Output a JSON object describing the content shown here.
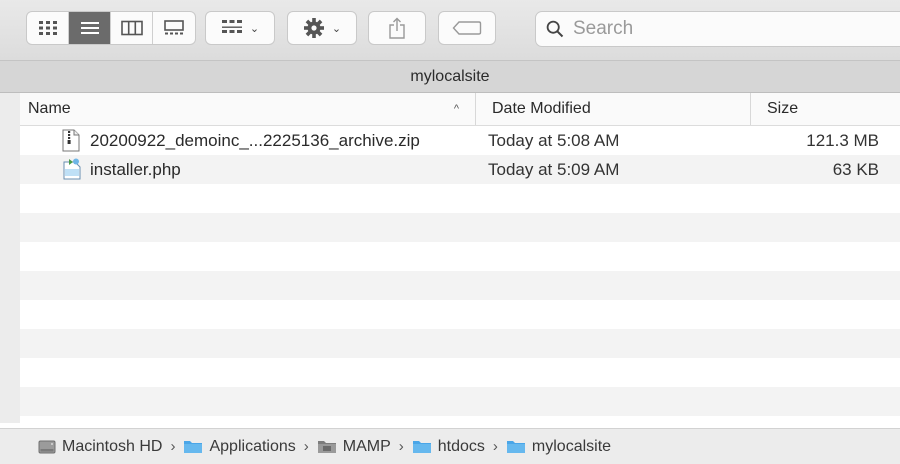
{
  "toolbar": {
    "view_buttons": [
      "icon-view",
      "list-view",
      "column-view",
      "gallery-view"
    ],
    "active_view": "list-view",
    "search_placeholder": "Search"
  },
  "window": {
    "title": "mylocalsite"
  },
  "columns": {
    "name": "Name",
    "date_modified": "Date Modified",
    "size": "Size",
    "sort_indicator": "^"
  },
  "files": [
    {
      "name": "20200922_demoinc_...2225136_archive.zip",
      "date": "Today at 5:08 AM",
      "size": "121.3 MB",
      "icon": "zip-file-icon"
    },
    {
      "name": "installer.php",
      "date": "Today at 5:09 AM",
      "size": "63 KB",
      "icon": "php-file-icon"
    }
  ],
  "path": {
    "items": [
      {
        "label": "Macintosh HD",
        "icon": "hard-drive-icon"
      },
      {
        "label": "Applications",
        "icon": "folder-icon"
      },
      {
        "label": "MAMP",
        "icon": "folder-icon"
      },
      {
        "label": "htdocs",
        "icon": "folder-icon"
      },
      {
        "label": "mylocalsite",
        "icon": "folder-icon"
      }
    ],
    "separator": "›"
  },
  "colors": {
    "folder_blue": "#4aa6e8",
    "grey_folder": "#8e8e8e",
    "active_segment": "#6b6b6b"
  }
}
